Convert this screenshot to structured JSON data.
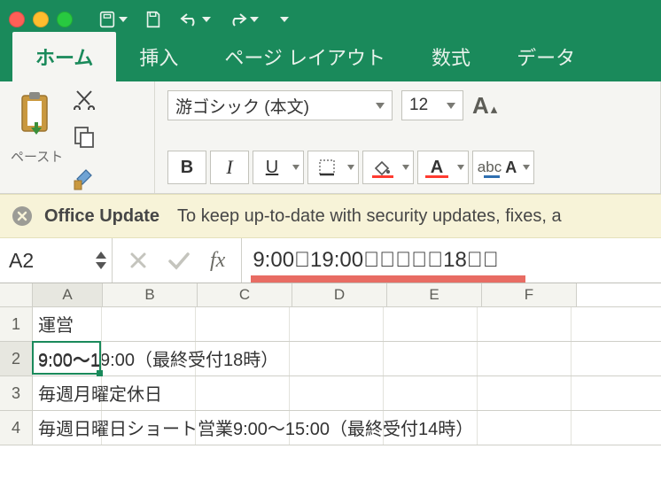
{
  "titlebar": {},
  "ribbon": {
    "tabs": [
      "ホーム",
      "挿入",
      "ページ レイアウト",
      "数式",
      "データ"
    ],
    "active_tab": "ホーム",
    "paste_label": "ペースト",
    "font_name": "游ゴシック (本文)",
    "font_size": "12",
    "bold": "B",
    "italic": "I",
    "underline": "U",
    "abc_label": "abc"
  },
  "notice": {
    "title": "Office Update",
    "text": "To keep up-to-date with security updates, fixes, a"
  },
  "formula_bar": {
    "name_box": "A2",
    "fx_label": "fx",
    "value": "9:00￿19:00￿￿￿￿￿18￿￿"
  },
  "sheet": {
    "columns": [
      "A",
      "B",
      "C",
      "D",
      "E",
      "F"
    ],
    "rows": [
      {
        "num": "1",
        "text": "運営"
      },
      {
        "num": "2",
        "text": "9:00～19:00（最終受付18時）"
      },
      {
        "num": "3",
        "text": "毎週月曜定休日"
      },
      {
        "num": "4",
        "text": "毎週日曜日ショート営業9:00～15:00（最終受付14時）"
      }
    ],
    "active_cell": "A2",
    "active_display": "9:00～1"
  }
}
